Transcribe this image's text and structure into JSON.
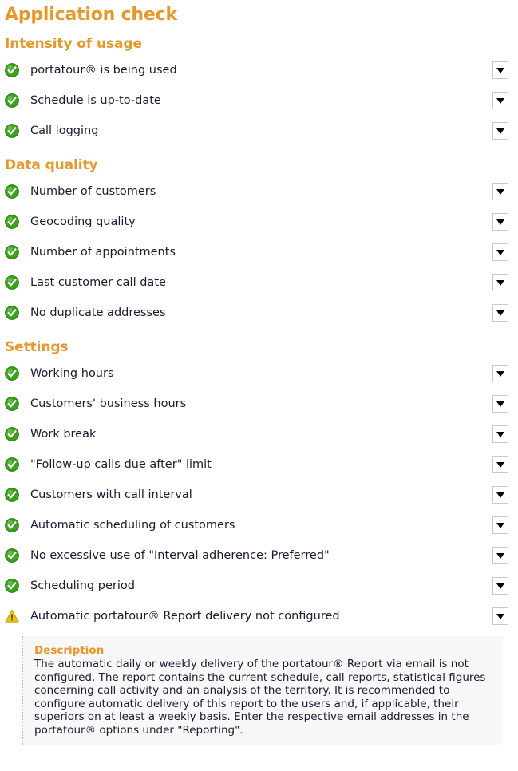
{
  "page": {
    "title": "Application check"
  },
  "icons": {
    "ok": "check-circle-icon",
    "warning": "warning-triangle-icon",
    "caret": "chevron-down-icon"
  },
  "colors": {
    "accent_orange": "#e8982a",
    "ok_green": "#3aa31a",
    "warning_yellow": "#f1c40f",
    "text": "#1b1b33",
    "panel_bg": "#f8f8f8",
    "dotted_border": "#b9b9b9"
  },
  "sections": [
    {
      "heading": "Intensity of usage",
      "items": [
        {
          "status": "ok",
          "label": "portatour® is being used",
          "expand_label": "▼"
        },
        {
          "status": "ok",
          "label": "Schedule is up-to-date",
          "expand_label": "▼"
        },
        {
          "status": "ok",
          "label": "Call logging",
          "expand_label": "▼"
        }
      ]
    },
    {
      "heading": "Data quality",
      "items": [
        {
          "status": "ok",
          "label": "Number of customers",
          "expand_label": "▼"
        },
        {
          "status": "ok",
          "label": "Geocoding quality",
          "expand_label": "▼"
        },
        {
          "status": "ok",
          "label": "Number of appointments",
          "expand_label": "▼"
        },
        {
          "status": "ok",
          "label": "Last customer call date",
          "expand_label": "▼"
        },
        {
          "status": "ok",
          "label": "No duplicate addresses",
          "expand_label": "▼"
        }
      ]
    },
    {
      "heading": "Settings",
      "items": [
        {
          "status": "ok",
          "label": "Working hours",
          "expand_label": "▼"
        },
        {
          "status": "ok",
          "label": "Customers' business hours",
          "expand_label": "▼"
        },
        {
          "status": "ok",
          "label": "Work break",
          "expand_label": "▼"
        },
        {
          "status": "ok",
          "label": "\"Follow-up calls due after\" limit",
          "expand_label": "▼"
        },
        {
          "status": "ok",
          "label": "Customers with call interval",
          "expand_label": "▼"
        },
        {
          "status": "ok",
          "label": "Automatic scheduling of customers",
          "expand_label": "▼"
        },
        {
          "status": "ok",
          "label": "No excessive use of \"Interval adherence: Preferred\"",
          "expand_label": "▼"
        },
        {
          "status": "ok",
          "label": "Scheduling period",
          "expand_label": "▼"
        },
        {
          "status": "warning",
          "label": "Automatic portatour® Report delivery not configured",
          "expand_label": "▼",
          "expanded": true
        }
      ]
    }
  ],
  "description": {
    "title": "Description",
    "body": "The automatic daily or weekly delivery of the portatour® Report via email is not configured. The report contains the current schedule, call reports, statistical figures concerning call activity and an analysis of the territory. It is recommended to configure automatic delivery of this report to the users and, if applicable, their superiors on at least a weekly basis. Enter the respective email addresses in the portatour® options under \"Reporting\"."
  }
}
